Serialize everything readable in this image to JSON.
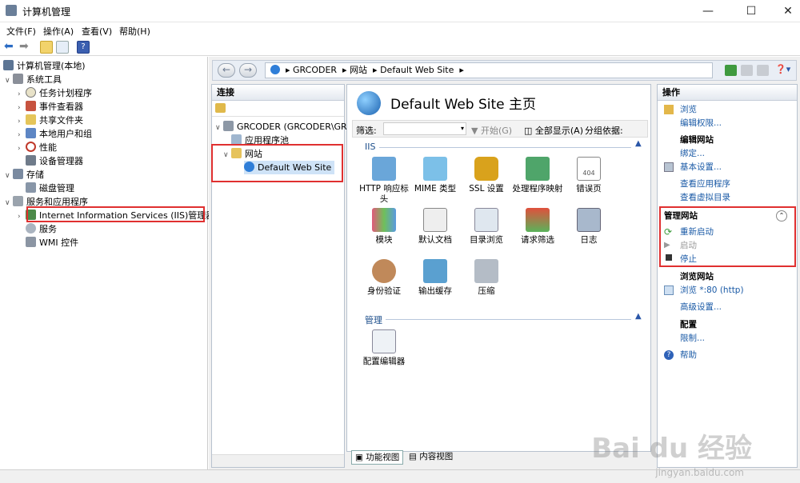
{
  "window": {
    "title": "计算机管理",
    "minimize": "—",
    "maximize": "☐",
    "close": "✕"
  },
  "menubar": [
    "文件(F)",
    "操作(A)",
    "查看(V)",
    "帮助(H)"
  ],
  "left_tree": {
    "root": "计算机管理(本地)",
    "system_tools": "系统工具",
    "system_children": [
      "任务计划程序",
      "事件查看器",
      "共享文件夹",
      "本地用户和组",
      "性能",
      "设备管理器"
    ],
    "storage": "存储",
    "storage_children": [
      "磁盘管理"
    ],
    "services_apps": "服务和应用程序",
    "services_children": [
      "Internet Information Services (IIS)管理器",
      "服务",
      "WMI 控件"
    ]
  },
  "address": {
    "path": [
      "GRCODER",
      "网站",
      "Default Web Site"
    ]
  },
  "connections": {
    "header": "连接",
    "server": "GRCODER (GRCODER\\GR",
    "app_pools": "应用程序池",
    "sites": "网站",
    "default_site": "Default Web Site"
  },
  "center": {
    "title": "Default Web Site 主页",
    "filter_label": "筛选:",
    "start_btn": "开始(G)",
    "show_all_btn": "全部显示(A)",
    "group_label": "分组依据:",
    "section_iis": "IIS",
    "features_iis": [
      "HTTP 响应标头",
      "MIME 类型",
      "SSL 设置",
      "处理程序映射",
      "错误页",
      "模块",
      "默认文档",
      "目录浏览",
      "请求筛选",
      "日志",
      "身份验证",
      "输出缓存",
      "压缩"
    ],
    "section_manage": "管理",
    "features_manage": [
      "配置编辑器"
    ],
    "tab_features": "功能视图",
    "tab_content": "内容视图"
  },
  "actions": {
    "header": "操作",
    "browse": "浏览",
    "edit_perms": "编辑权限...",
    "edit_site_hdr": "编辑网站",
    "bindings": "绑定...",
    "basic_settings": "基本设置...",
    "view_apps": "查看应用程序",
    "view_vdirs": "查看虚拟目录",
    "manage_site_hdr": "管理网站",
    "restart": "重新启动",
    "start": "启动",
    "stop": "停止",
    "browse_site_hdr": "浏览网站",
    "browse_80": "浏览 *:80 (http)",
    "advanced": "高级设置...",
    "config_hdr": "配置",
    "limits": "限制...",
    "help": "帮助"
  },
  "watermark": {
    "main": "Bai du 经验",
    "sub": "jingyan.baidu.com"
  }
}
